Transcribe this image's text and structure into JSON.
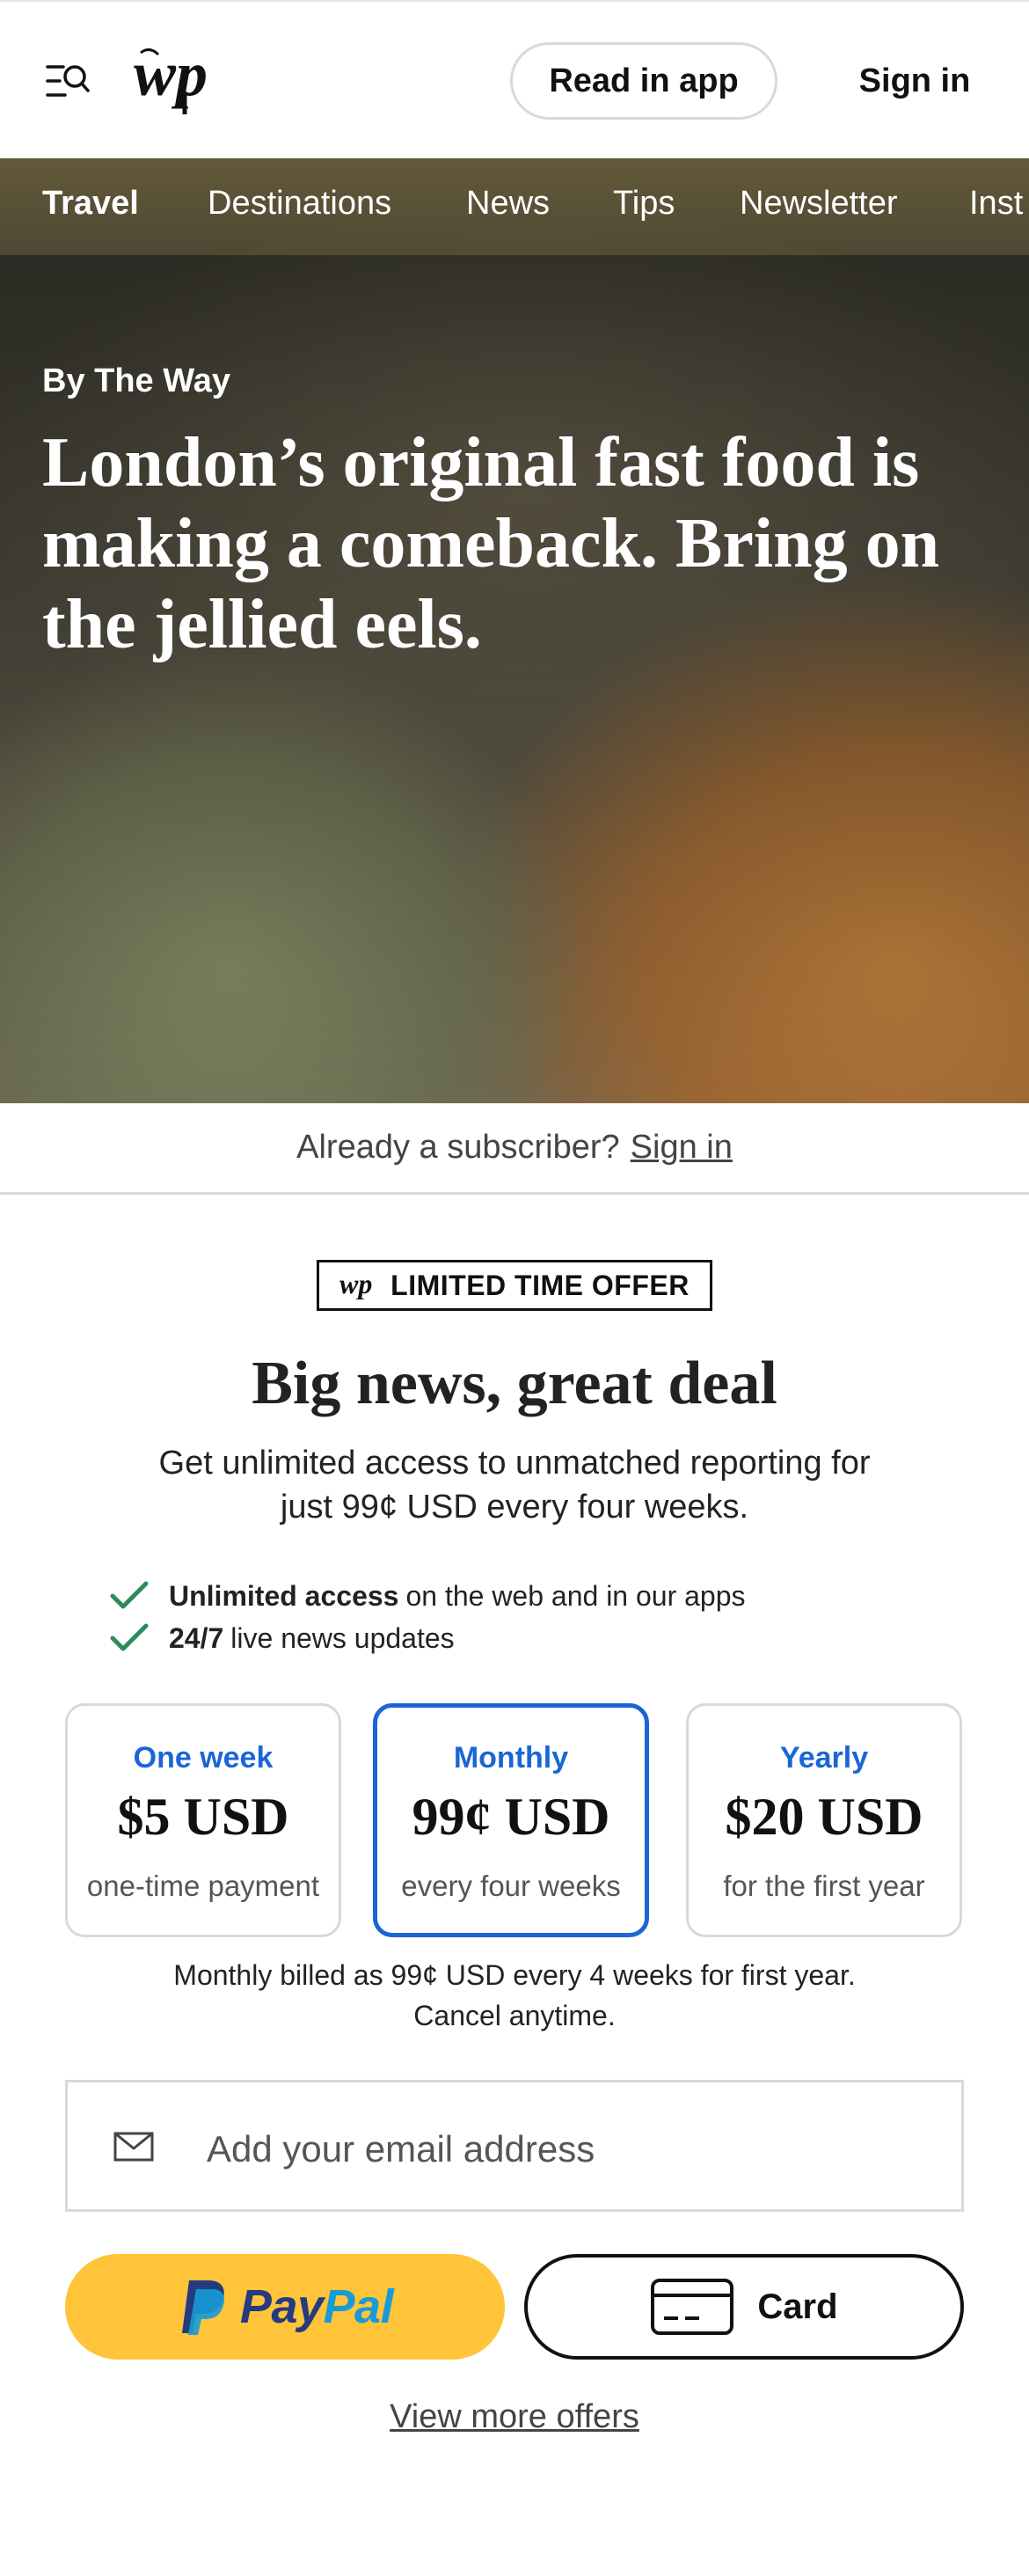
{
  "header": {
    "menu_icon": "menu-search-icon",
    "logo_icon": "wp-logo-icon",
    "read_in_app_label": "Read in app",
    "sign_in_label": "Sign in"
  },
  "subnav": {
    "items": [
      {
        "label": "Travel",
        "active": true
      },
      {
        "label": "Destinations",
        "active": false
      },
      {
        "label": "News",
        "active": false
      },
      {
        "label": "Tips",
        "active": false
      },
      {
        "label": "Newsletter",
        "active": false
      },
      {
        "label": "Inst",
        "active": false
      }
    ]
  },
  "article": {
    "kicker": "By The Way",
    "headline": "London’s original fast food is making a comeback. Bring on the jellied eels."
  },
  "subscriber": {
    "prompt": "Already a subscriber?",
    "link": "Sign in"
  },
  "offer": {
    "badge": "LIMITED TIME OFFER",
    "title": "Big news, great deal",
    "description": "Get unlimited access to unmatched reporting for just 99¢ USD every four weeks.",
    "benefits": [
      {
        "bold": "Unlimited access",
        "rest": "on the web and in our apps"
      },
      {
        "bold": "24/7",
        "rest": "live news updates"
      }
    ],
    "check_color": "#2e8b57",
    "accent_color": "#1b66d6",
    "plans": [
      {
        "name": "One week",
        "price": "$5 USD",
        "term": "one-time payment",
        "selected": false
      },
      {
        "name": "Monthly",
        "price": "99¢ USD",
        "term": "every four weeks",
        "selected": true
      },
      {
        "name": "Yearly",
        "price": "$20 USD",
        "term": "for the first year",
        "selected": false
      }
    ],
    "billing_note_1": "Monthly billed as 99¢ USD every 4 weeks for first year.",
    "billing_note_2": "Cancel anytime."
  },
  "email": {
    "placeholder": "Add your email address",
    "value": ""
  },
  "payment": {
    "paypal_part1": "Pay",
    "paypal_part2": "Pal",
    "paypal_bg": "#ffc439",
    "card_label": "Card"
  },
  "footer": {
    "view_more": "View more offers"
  }
}
